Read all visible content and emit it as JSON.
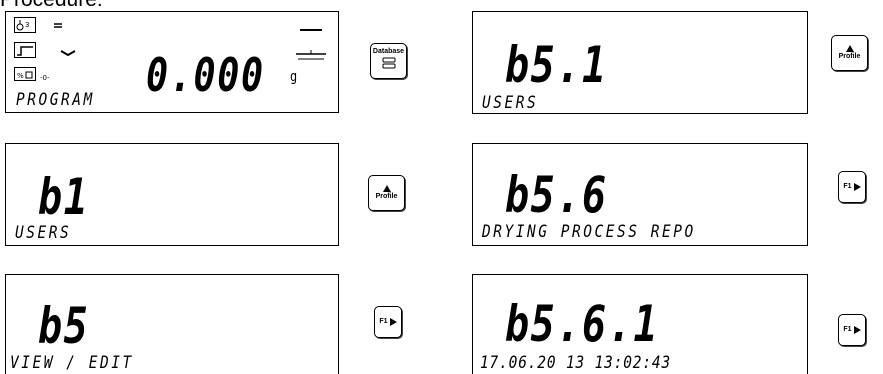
{
  "heading": "Procedure:",
  "panels": [
    {
      "main": "0.000",
      "unit": "g",
      "sub": "PROGRAM"
    },
    {
      "main": "b5.1",
      "sub": "USERS"
    },
    {
      "main": "b1",
      "sub": "USERS"
    },
    {
      "main": "b5.6",
      "sub": "DRYING PROCESS REPO"
    },
    {
      "main": "b5",
      "sub": "VIEW / EDIT"
    },
    {
      "main": "b5.6.1",
      "sub": "17.06.20 13   13:02:43"
    }
  ],
  "indicators": {
    "stability": "-0-"
  },
  "keys": {
    "database_label": "Database",
    "profile_label": "Profile",
    "f1_label": "F1"
  }
}
